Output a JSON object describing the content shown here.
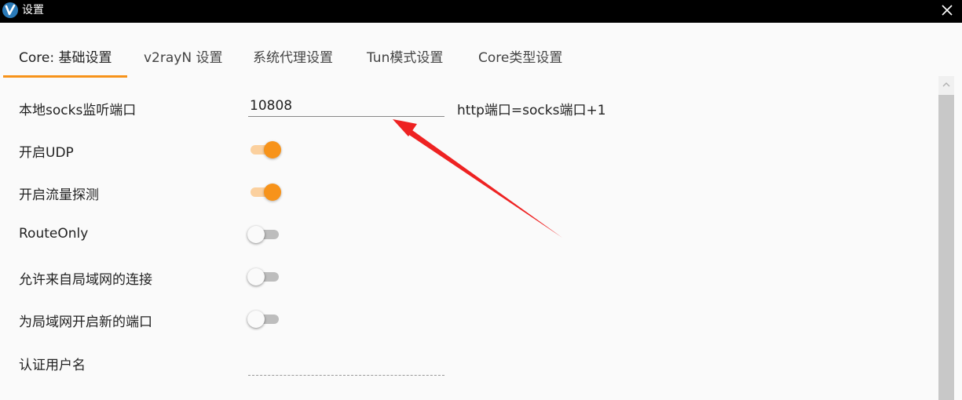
{
  "window": {
    "title": "设置",
    "logo_icon": "v2rayn-logo-icon",
    "close_icon": "close-icon"
  },
  "tabs": [
    {
      "label": "Core: 基础设置",
      "active": true
    },
    {
      "label": "v2rayN 设置",
      "active": false
    },
    {
      "label": "系统代理设置",
      "active": false
    },
    {
      "label": "Tun模式设置",
      "active": false
    },
    {
      "label": "Core类型设置",
      "active": false
    }
  ],
  "form": {
    "socks_port": {
      "label": "本地socks监听端口",
      "value": "10808",
      "hint": "http端口=socks端口+1"
    },
    "udp": {
      "label": "开启UDP",
      "on": true
    },
    "sniffing": {
      "label": "开启流量探测",
      "on": true
    },
    "route_only": {
      "label": "RouteOnly",
      "on": false
    },
    "allow_lan": {
      "label": "允许来自局域网的连接",
      "on": false
    },
    "new_lan_port": {
      "label": "为局域网开启新的端口",
      "on": false
    },
    "auth_user": {
      "label": "认证用户名",
      "value": ""
    }
  },
  "colors": {
    "accent": "#f7931a",
    "titlebar": "#000000",
    "annotation_arrow": "#ee2222"
  }
}
